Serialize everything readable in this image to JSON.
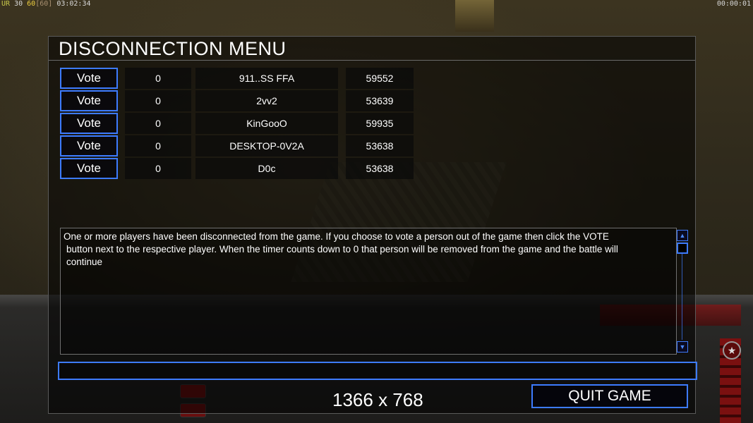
{
  "overlay": {
    "top_left": {
      "ur_label": "UR",
      "ur_value": "30",
      "fps": "60",
      "fps_cap": "[60]",
      "clock": "03:02:34"
    },
    "top_right": {
      "timer": "00:00:01"
    }
  },
  "dialog": {
    "title": "DISCONNECTION MENU",
    "players": [
      {
        "vote_label": "Vote",
        "count": "0",
        "name": "911..SS FFA",
        "ping": "59552"
      },
      {
        "vote_label": "Vote",
        "count": "0",
        "name": "2vv2",
        "ping": "53639"
      },
      {
        "vote_label": "Vote",
        "count": "0",
        "name": "KinGooO",
        "ping": "59935"
      },
      {
        "vote_label": "Vote",
        "count": "0",
        "name": "DESKTOP-0V2A",
        "ping": "53638"
      },
      {
        "vote_label": "Vote",
        "count": "0",
        "name": "D0c",
        "ping": "53638"
      }
    ],
    "message_line1": "One or more players have been disconnected from the game. If you choose to vote a person out of the game then click the VOTE",
    "message_line2": "button next to the respective player. When the timer counts down to 0 that person will be removed from the game and the battle will",
    "message_line3": "continue",
    "chat_value": "",
    "resolution": "1366 x 768",
    "quit_label": "QUIT GAME"
  },
  "colors": {
    "accent_border": "#3d7bff",
    "panel_bg": "rgba(0,0,0,0.55)",
    "text": "#ffffff"
  },
  "icons": {
    "scroll_up": "scroll-up-icon",
    "scroll_down": "scroll-down-icon",
    "hud_star": "star-icon"
  }
}
